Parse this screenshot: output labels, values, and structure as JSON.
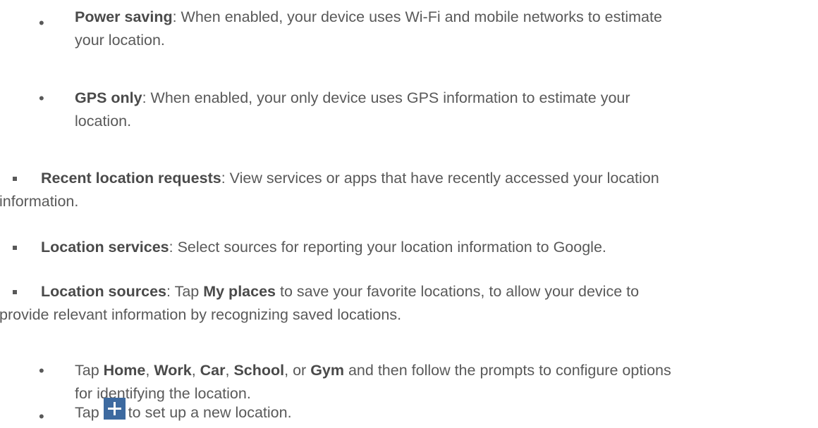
{
  "items": {
    "power_saving": {
      "title": "Power saving",
      "text_line1": ": When enabled, your device uses Wi-Fi and mobile networks to estimate",
      "text_line2": "your location."
    },
    "gps_only": {
      "title": "GPS only",
      "text_line1": ": When enabled, your only device uses GPS information to estimate your",
      "text_line2": "location."
    },
    "recent_requests": {
      "title": "Recent location requests",
      "text_line1": ": View services or apps that have recently accessed your location",
      "text_line2": "information."
    },
    "location_services": {
      "title": "Location services",
      "text_line1": ": Select sources for reporting your location information to Google."
    },
    "location_sources": {
      "title": "Location sources",
      "text_a": ": Tap ",
      "my_places": "My places",
      "text_b": " to save your favorite locations, to allow your device to",
      "text_line2": "provide relevant information by recognizing saved locations."
    },
    "tap_places": {
      "tap": "Tap ",
      "home": "Home",
      "sep1": ", ",
      "work": "Work",
      "sep2": ", ",
      "car": "Car",
      "sep3": ", ",
      "school": "School",
      "sep4": ", or ",
      "gym": "Gym",
      "text_rest": " and then follow the prompts to configure options",
      "text_line2": "for identifying the location."
    },
    "tap_add": {
      "tap": "Tap",
      "icon": "add-icon",
      "text_rest": "to set up a new location."
    }
  },
  "colors": {
    "text": "#595959",
    "icon_bg": "#3d6aa0"
  }
}
